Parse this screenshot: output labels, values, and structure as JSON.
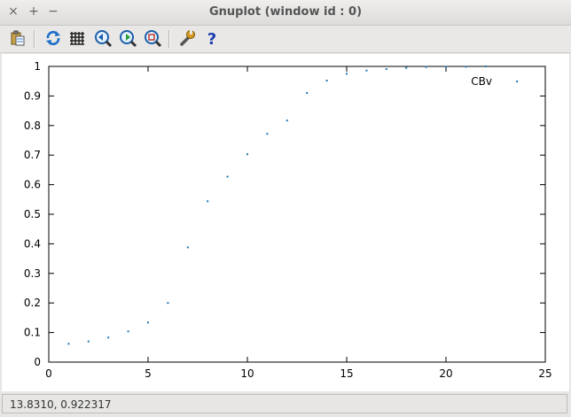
{
  "window": {
    "title": "Gnuplot (window id : 0)",
    "buttons": [
      "×",
      "+",
      "−"
    ]
  },
  "toolbar": {
    "icons": [
      "clipboard-icon",
      "replot-icon",
      "grid-icon",
      "zoom-previous-icon",
      "zoom-next-icon",
      "unzoom-icon",
      "settings-wrench-icon",
      "help-icon"
    ]
  },
  "status": {
    "coordinates": "13.8310,  0.922317"
  },
  "colors": {
    "points": "#1f77b4"
  },
  "chart_data": {
    "type": "scatter",
    "title": "",
    "xlabel": "",
    "ylabel": "",
    "xlim": [
      0,
      25
    ],
    "ylim": [
      0,
      1
    ],
    "x_ticks": [
      0,
      5,
      10,
      15,
      20,
      25
    ],
    "y_ticks": [
      0,
      0.1,
      0.2,
      0.3,
      0.4,
      0.5,
      0.6,
      0.7,
      0.8,
      0.9,
      1
    ],
    "grid": false,
    "legend": "top-right",
    "series": [
      {
        "name": "CBv",
        "x": [
          1,
          2,
          3,
          4,
          5,
          6,
          7,
          8,
          9,
          10,
          11,
          12,
          13,
          14,
          15,
          16,
          17,
          18,
          19,
          20,
          21,
          22
        ],
        "y": [
          0.062,
          0.07,
          0.083,
          0.104,
          0.134,
          0.2,
          0.388,
          0.544,
          0.627,
          0.703,
          0.772,
          0.817,
          0.91,
          0.952,
          0.975,
          0.986,
          0.991,
          0.995,
          0.998,
          0.999,
          0.999,
          1.0
        ]
      }
    ]
  }
}
